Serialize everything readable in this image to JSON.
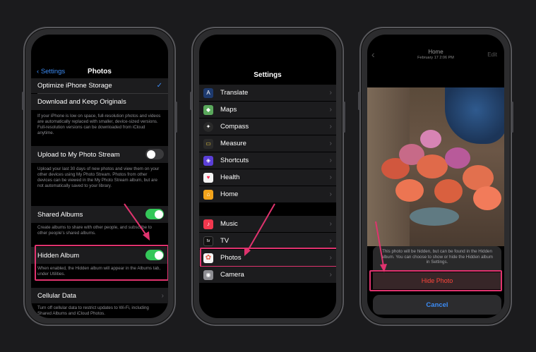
{
  "phone1": {
    "back_label": "Settings",
    "title": "Photos",
    "optimize_label": "Optimize iPhone Storage",
    "checkmark": "✓",
    "download_label": "Download and Keep Originals",
    "storage_note": "If your iPhone is low on space, full-resolution photos and videos are automatically replaced with smaller, device-sized versions. Full-resolution versions can be downloaded from iCloud anytime.",
    "photostream_label": "Upload to My Photo Stream",
    "photostream_note": "Upload your last 30 days of new photos and view them on your other devices using My Photo Stream. Photos from other devices can be viewed in the My Photo Stream album, but are not automatically saved to your library.",
    "shared_label": "Shared Albums",
    "shared_note": "Create albums to share with other people, and subscribe to other people's shared albums.",
    "hidden_label": "Hidden Album",
    "hidden_note": "When enabled, the Hidden album will appear in the Albums tab, under Utilities.",
    "cellular_label": "Cellular Data",
    "cellular_note": "Turn off cellular data to restrict updates to Wi-Fi, including Shared Albums and iCloud Photos.",
    "photostream_on": false,
    "shared_on": true,
    "hidden_on": true
  },
  "phone2": {
    "title": "Settings",
    "group1": [
      {
        "label": "Translate",
        "icon": "translate-icon",
        "color": "#1e3a6e"
      },
      {
        "label": "Maps",
        "icon": "maps-icon",
        "color": "#5aa85c"
      },
      {
        "label": "Compass",
        "icon": "compass-icon",
        "color": "#2a2a2a"
      },
      {
        "label": "Measure",
        "icon": "measure-icon",
        "color": "#2a2a2a"
      },
      {
        "label": "Shortcuts",
        "icon": "shortcuts-icon",
        "color": "#5b3fd8"
      },
      {
        "label": "Health",
        "icon": "health-icon",
        "color": "#f4f4f4"
      },
      {
        "label": "Home",
        "icon": "home-icon",
        "color": "#f2a31b"
      }
    ],
    "group2": [
      {
        "label": "Music",
        "icon": "music-icon",
        "color": "#f2384e"
      },
      {
        "label": "TV",
        "icon": "tv-icon",
        "color": "#111111"
      },
      {
        "label": "Photos",
        "icon": "photos-icon",
        "color": "#f4f4f4"
      },
      {
        "label": "Camera",
        "icon": "camera-icon",
        "color": "#8e8e93"
      }
    ],
    "tv_glyph": "tv"
  },
  "phone3": {
    "title": "Home",
    "date": "February 17  2:06 PM",
    "edit_label": "Edit",
    "back_glyph": "‹",
    "sheet_message": "This photo will be hidden, but can be found in the Hidden album. You can choose to show or hide the Hidden album in Settings.",
    "hide_label": "Hide Photo",
    "cancel_label": "Cancel"
  },
  "colors": {
    "highlight": "#e0336e",
    "toggle_on": "#34c759",
    "link_blue": "#3c8cf5",
    "destructive": "#ff453a"
  }
}
